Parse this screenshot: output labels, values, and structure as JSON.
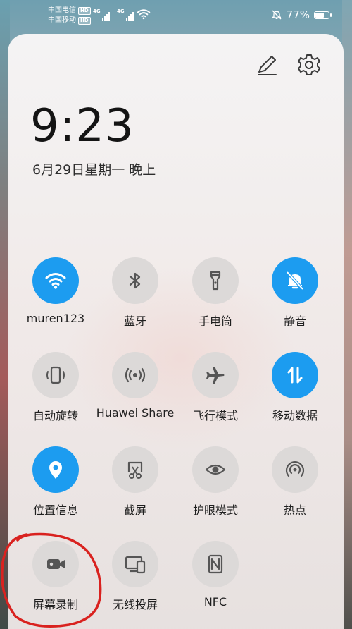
{
  "status_bar": {
    "carrier1": "中国电信",
    "carrier2": "中国移动",
    "hd_badge": "HD",
    "net1": "4G",
    "net2": "4G",
    "battery_percent": "77%",
    "battery_level": 0.77
  },
  "panel": {
    "time": "9:23",
    "date": "6月29日星期一 晚上"
  },
  "tiles": [
    {
      "label": "muren123",
      "icon": "wifi-icon",
      "on": true
    },
    {
      "label": "蓝牙",
      "icon": "bluetooth-icon",
      "on": false
    },
    {
      "label": "手电筒",
      "icon": "flashlight-icon",
      "on": false
    },
    {
      "label": "静音",
      "icon": "bell-muted-icon",
      "on": true
    },
    {
      "label": "自动旋转",
      "icon": "auto-rotate-icon",
      "on": false
    },
    {
      "label": "Huawei Share",
      "icon": "huawei-share-icon",
      "on": false
    },
    {
      "label": "飞行模式",
      "icon": "airplane-icon",
      "on": false
    },
    {
      "label": "移动数据",
      "icon": "mobile-data-icon",
      "on": true
    },
    {
      "label": "位置信息",
      "icon": "location-icon",
      "on": true
    },
    {
      "label": "截屏",
      "icon": "screenshot-icon",
      "on": false
    },
    {
      "label": "护眼模式",
      "icon": "eye-icon",
      "on": false
    },
    {
      "label": "热点",
      "icon": "hotspot-icon",
      "on": false
    },
    {
      "label": "屏幕录制",
      "icon": "screen-record-icon",
      "on": false
    },
    {
      "label": "无线投屏",
      "icon": "wireless-projection-icon",
      "on": false
    },
    {
      "label": "NFC",
      "icon": "nfc-icon",
      "on": false
    }
  ],
  "colors": {
    "accent_on": "#1c9cf0",
    "tile_off": "#dcd9d8",
    "annotation": "#d9221f"
  }
}
